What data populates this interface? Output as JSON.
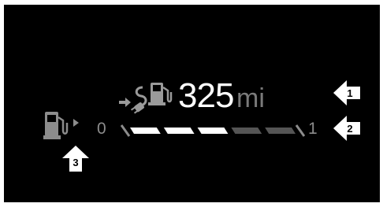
{
  "display": {
    "range_value": "325",
    "range_unit": "mi",
    "range_icon": "fuel-pump-with-charging-plug-icon",
    "fuel_icon": "fuel-pump-icon"
  },
  "fuel_gauge": {
    "scale_min": "0",
    "scale_max": "1",
    "segments_total": 5,
    "segments_filled": 3,
    "fill_color": "#ffffff",
    "empty_color": "#555555"
  },
  "callouts": [
    {
      "number": "1"
    },
    {
      "number": "2"
    },
    {
      "number": "3"
    }
  ],
  "colors": {
    "background": "#000000",
    "primary_text": "#ffffff",
    "secondary_text": "#7a7a7a",
    "icon_gray": "#8c8c8c"
  }
}
